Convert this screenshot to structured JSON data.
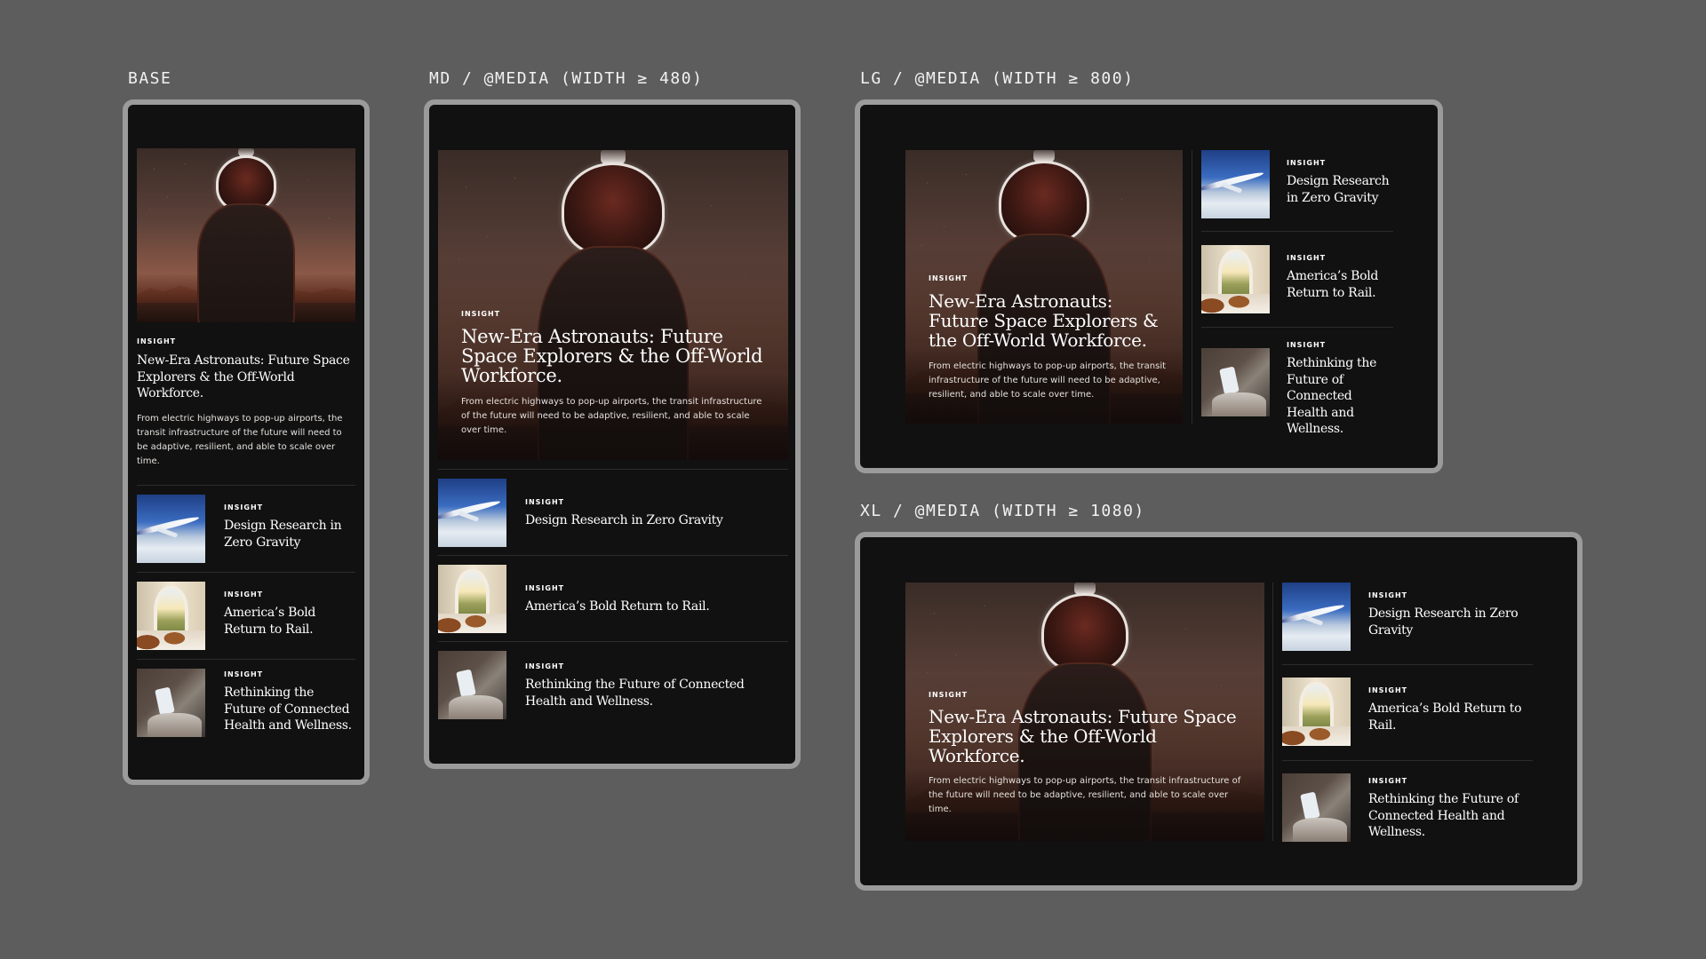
{
  "breakpoints": {
    "base": {
      "label": "BASE"
    },
    "md": {
      "label": "MD / @MEDIA (WIDTH ≥ 480)"
    },
    "lg": {
      "label": "LG / @MEDIA (WIDTH ≥ 800)"
    },
    "xl": {
      "label": "XL / @MEDIA (WIDTH ≥ 1080)"
    }
  },
  "feature": {
    "eyebrow": "INSIGHT",
    "title": "New-Era Astronauts: Future Space Explorers & the Off-World Workforce.",
    "description": "From electric highways to pop-up airports, the transit infrastructure of the future will need to be adaptive, resilient, and able to scale over time.",
    "image": "astronaut-on-mars-photo"
  },
  "articles": [
    {
      "eyebrow": "INSIGHT",
      "title": "Design Research in Zero Gravity",
      "image": "airplane-above-clouds-photo"
    },
    {
      "eyebrow": "INSIGHT",
      "title": "America’s Bold Return to Rail.",
      "image": "train-interior-photo"
    },
    {
      "eyebrow": "INSIGHT",
      "title": "Rethinking the Future of Connected Health and Wellness.",
      "image": "person-with-tablet-photo"
    }
  ],
  "colors": {
    "page_background": "#5d5d5d",
    "frame_border": "#9b9b9b",
    "card_background": "#111111",
    "text": "#ffffff"
  }
}
